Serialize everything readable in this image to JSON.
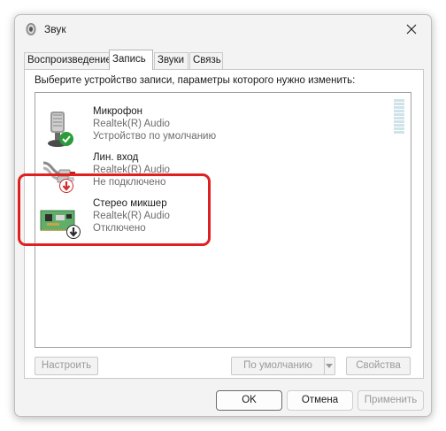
{
  "window": {
    "title": "Звук",
    "icon": "speaker-icon"
  },
  "tabs": [
    {
      "label": "Воспроизведение",
      "active": false
    },
    {
      "label": "Запись",
      "active": true
    },
    {
      "label": "Звуки",
      "active": false
    },
    {
      "label": "Связь",
      "active": false
    }
  ],
  "panel": {
    "instruction": "Выберите устройство записи, параметры которого нужно изменить:"
  },
  "devices": [
    {
      "name": "Микрофон",
      "driver": "Realtek(R) Audio",
      "status": "Устройство по умолчанию",
      "icon": "microphone-icon",
      "badge": "default-check-icon",
      "badge_color": "#2a9d3a"
    },
    {
      "name": "Лин. вход",
      "driver": "Realtek(R) Audio",
      "status": "Не подключено",
      "icon": "line-in-cable-icon",
      "badge": "disconnected-arrow-icon",
      "badge_color": "#d42a2a"
    },
    {
      "name": "Стерео микшер",
      "driver": "Realtek(R) Audio",
      "status": "Отключено",
      "icon": "sound-card-icon",
      "badge": "disabled-arrow-icon",
      "badge_color": "#2b2b2b"
    }
  ],
  "highlight_color": "#e02020",
  "buttons": {
    "configure": "Настроить",
    "set_default": "По умолчанию",
    "properties": "Свойства",
    "ok": "OK",
    "cancel": "Отмена",
    "apply": "Применить"
  }
}
